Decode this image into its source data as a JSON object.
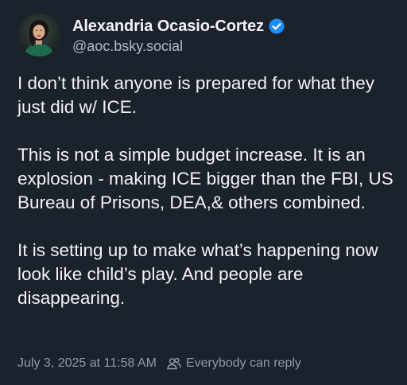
{
  "author": {
    "display_name": "Alexandria Ocasio-Cortez",
    "handle": "@aoc.bsky.social",
    "verified_color": "#1d8cf8",
    "avatar_icon": "user-avatar"
  },
  "post": {
    "paragraphs": [
      "I don’t think anyone is prepared for what they just did w/ ICE.",
      "This is not a simple budget increase. It is an explosion - making ICE bigger than the FBI, US Bureau of Prisons, DEA,& others combined.",
      "It is setting up to make what’s happening now look like child’s play. And people are disappearing."
    ]
  },
  "meta": {
    "timestamp": "July 3, 2025 at 11:58 AM",
    "reply_setting": "Everybody can reply",
    "reply_icon": "people-icon"
  },
  "colors": {
    "background": "#1b222c",
    "text": "#f1f3f5",
    "muted": "#8f9bab"
  }
}
